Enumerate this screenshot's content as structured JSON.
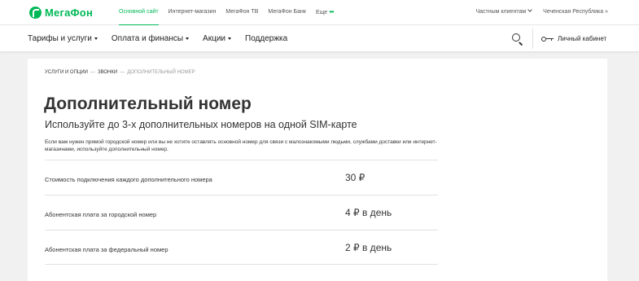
{
  "header": {
    "logo_text": "МегаФон",
    "top_links": [
      {
        "label": "Основной сайт",
        "active": true
      },
      {
        "label": "Интернет-магазин",
        "active": false
      },
      {
        "label": "МегаФон ТВ",
        "active": false
      },
      {
        "label": "МегаФон Банк",
        "active": false
      },
      {
        "label": "Еще",
        "active": false
      }
    ],
    "more_dots": "•••",
    "client_type": "Частным клиентам",
    "region": "Чеченская Республика »",
    "accent_color": "#00b956"
  },
  "nav": {
    "items": [
      {
        "label": "Тарифы и услуги",
        "has_dropdown": true
      },
      {
        "label": "Оплата и финансы",
        "has_dropdown": true
      },
      {
        "label": "Акции",
        "has_dropdown": true
      },
      {
        "label": "Поддержка",
        "has_dropdown": false
      }
    ],
    "search_icon": "search-icon",
    "cabinet_icon": "key-icon",
    "cabinet_label": "Личный кабинет"
  },
  "breadcrumb": {
    "items": [
      "Услуги и опции",
      "Звонки"
    ],
    "separator": "—",
    "current": "Дополнительный номер"
  },
  "page": {
    "title": "Дополнительный номер",
    "subtitle": "Используйте до 3-х дополнительных номеров на одной SIM-карте",
    "description": "Если вам нужен прямой городской номер или вы не хотите оставлять основной номер для связи с малознакомыми людьми, службами доставки или интернет-магазинами, используйте дополнительный номер."
  },
  "prices": [
    {
      "label": "Стоимость подключения каждого дополнительного номера",
      "value": "30 ₽"
    },
    {
      "label": "Абонентская плата за городской номер",
      "value": "4 ₽ в день"
    },
    {
      "label": "Абонентская плата за федеральный номер",
      "value": "2 ₽ в день"
    }
  ]
}
